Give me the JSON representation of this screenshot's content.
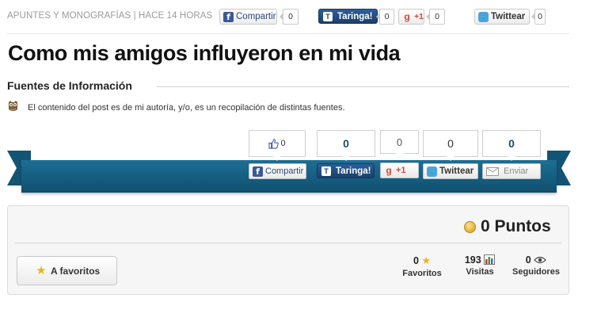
{
  "meta": {
    "text": "APUNTES Y MONOGRAFÍAS | HACE 14 HORAS",
    "facebook_label": "Compartir",
    "facebook_count": "0",
    "taringa_label": "Taringa!",
    "taringa_count": "0",
    "gplus_label": "+1",
    "gplus_count": "0",
    "twitter_label": "Twittear",
    "twitter_count": "0"
  },
  "post": {
    "title": "Como mis amigos influyeron en mi vida"
  },
  "sources": {
    "heading": "Fuentes de Información",
    "text": "El contenido del post es de mi autoría, y/o, es un recopilación de distintas fuentes."
  },
  "share_ribbon": {
    "like_count": "0",
    "facebook_label": "Compartir",
    "taringa_count": "0",
    "taringa_label": "Taringa!",
    "gplus_count": "0",
    "gplus_label": "+1",
    "twitter_count": "0",
    "twitter_label": "Twittear",
    "email_count": "0",
    "email_label": "Enviar"
  },
  "stats": {
    "points_label": "0 Puntos",
    "favorites_button": "A favoritos",
    "favorites_count": "0",
    "favorites_label": "Favoritos",
    "visits_count": "193",
    "visits_label": "Visitas",
    "followers_count": "0",
    "followers_label": "Seguidores"
  },
  "colors": {
    "ribbon": "#1a6488",
    "counter_text": "#1f4d6b",
    "meta_text": "#9a9a9a"
  }
}
